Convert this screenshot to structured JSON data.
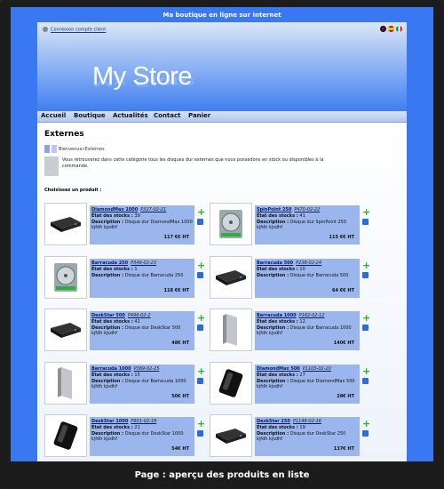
{
  "site_title": "Ma boutique en ligne sur Internet",
  "login_link": "Connexion compte client",
  "logo": "My Store",
  "nav": [
    "Accueil",
    "Boutique",
    "Actualités",
    "Contact",
    "Panier"
  ],
  "category": {
    "title": "Externes",
    "breadcrumb": "Bienvenue»Externes",
    "description": "Vous retrouverez dans cette catégorie tous les disques dur externes que nous possédons en stock ou disponibles à la commande.",
    "choose_label": "Choisissez un produit :"
  },
  "labels": {
    "stock": "Etat des stocks :",
    "description": "Description :"
  },
  "products": [
    {
      "name": "DiamondMax 1000",
      "ref": "P327-02-21",
      "stock": "39",
      "desc": "Disque dur DiamondMax 1000 kjfdh kjsdhf",
      "price": "117 €€ HT",
      "img": "enclosure-black"
    },
    {
      "name": "SpinPoint 250",
      "ref": "P470-02-22",
      "stock": "41",
      "desc": "Disque dur SpinPoint 250 kjfdh kjsdhf",
      "price": "115 €€ HT",
      "img": "bare-disk"
    },
    {
      "name": "Barracuda 250",
      "ref": "P349-02-23",
      "stock": "1",
      "desc": "Disque dur Barracuda 250",
      "price": "118 €€ HT",
      "img": "bare-disk"
    },
    {
      "name": "Barracuda 500",
      "ref": "P238-02-24",
      "stock": "10",
      "desc": "Disque dur Barracuda 500",
      "price": "64 €€ HT",
      "img": "enclosure-black"
    },
    {
      "name": "DeskStar 500",
      "ref": "P496-02-2",
      "stock": "41",
      "desc": "Disque dur DeskStar 500 kjfdh kjsdhf",
      "price": "48€ HT",
      "img": "enclosure-black"
    },
    {
      "name": "Barracuda 1000",
      "ref": "P162-02-12",
      "stock": "12",
      "desc": "Disque dur Barracuda 1000 kjfdh kjsdhf",
      "price": "140€ HT",
      "img": "tower-silver"
    },
    {
      "name": "Barracuda 1000",
      "ref": "P369-02-25",
      "stock": "15",
      "desc": "Disque dur Barracuda 1000 kjfdh kjsdhf",
      "price": "50€ HT",
      "img": "tower-silver"
    },
    {
      "name": "DiamondMax 500",
      "ref": "P1105-02-20",
      "stock": "27",
      "desc": "Disque dur DiamondMax 500 kjfdh kjsdhf",
      "price": "28€ HT",
      "img": "portable-black"
    },
    {
      "name": "DeskStar 1000",
      "ref": "P901-02-18",
      "stock": "21",
      "desc": "Disque dur DeskStar 1000 kjfdh kjsdhf",
      "price": "54€ HT",
      "img": "portable-black"
    },
    {
      "name": "DeskStar 250",
      "ref": "P1148-02-16",
      "stock": "19",
      "desc": "Disque dur DeskStar 250 kjfdh kjsdhf",
      "price": "137€ HT",
      "img": "enclosure-black"
    }
  ],
  "caption": "Page : aperçu des produits en liste"
}
